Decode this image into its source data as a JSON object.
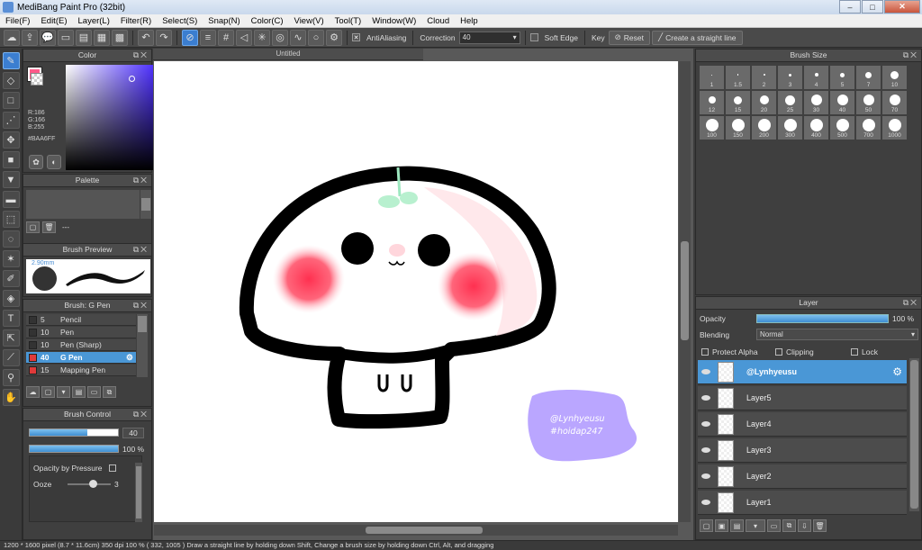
{
  "window": {
    "title": "MediBang Paint Pro (32bit)"
  },
  "menu": [
    "File(F)",
    "Edit(E)",
    "Layer(L)",
    "Filter(R)",
    "Select(S)",
    "Snap(N)",
    "Color(C)",
    "View(V)",
    "Tool(T)",
    "Window(W)",
    "Cloud",
    "Help"
  ],
  "toolbar": {
    "antialiasing_label": "AntiAliasing",
    "correction_label": "Correction",
    "correction_value": "40",
    "soft_edge_label": "Soft Edge",
    "key_label": "Key",
    "reset_label": "Reset",
    "straight_line_label": "Create a straight line"
  },
  "color_panel": {
    "title": "Color",
    "r": "R:186",
    "g": "G:166",
    "b": "B:255",
    "hex": "#BAA6FF",
    "fg_color": "#ff5a8a"
  },
  "palette_panel": {
    "title": "Palette",
    "footer_text": "---"
  },
  "brush_preview": {
    "title": "Brush Preview",
    "size_text": "2.90mm"
  },
  "brush_panel": {
    "title": "Brush: G Pen",
    "brushes": [
      {
        "size": "5",
        "name": "Pencil",
        "swatch": "#333333"
      },
      {
        "size": "10",
        "name": "Pen",
        "swatch": "#333333"
      },
      {
        "size": "10",
        "name": "Pen (Sharp)",
        "swatch": "#333333"
      },
      {
        "size": "40",
        "name": "G Pen",
        "swatch": "#e03a3a"
      },
      {
        "size": "15",
        "name": "Mapping Pen",
        "swatch": "#e03a3a"
      }
    ]
  },
  "brush_control": {
    "title": "Brush Control",
    "size_value": "40",
    "size_fraction": 0.65,
    "opacity_value": "100 %",
    "opacity_fraction": 1.0,
    "pressure_label": "Opacity by Pressure",
    "ooze_label": "Ooze",
    "ooze_value": "3"
  },
  "canvas": {
    "tab_title": "Untitled",
    "watermark_line1": "@Lynhyeusu",
    "watermark_line2": "#hoidap247"
  },
  "brush_size_panel": {
    "title": "Brush Size",
    "sizes": [
      "1",
      "1.5",
      "2",
      "3",
      "4",
      "5",
      "7",
      "10",
      "12",
      "15",
      "20",
      "25",
      "30",
      "40",
      "50",
      "70",
      "100",
      "150",
      "200",
      "300",
      "400",
      "500",
      "700",
      "1000"
    ]
  },
  "layer_panel": {
    "title": "Layer",
    "opacity_label": "Opacity",
    "opacity_value": "100 %",
    "blending_label": "Blending",
    "blending_value": "Normal",
    "protect_alpha_label": "Protect Alpha",
    "clipping_label": "Clipping",
    "lock_label": "Lock",
    "layers": [
      {
        "name": "@Lynhyeusu"
      },
      {
        "name": "Layer5"
      },
      {
        "name": "Layer4"
      },
      {
        "name": "Layer3"
      },
      {
        "name": "Layer2"
      },
      {
        "name": "Layer1"
      }
    ]
  },
  "status": {
    "text": "1200 * 1600 pixel   (8.7 * 11.6cm)   350 dpi   100 %   ( 332, 1005 )   Draw a straight line by holding down Shift, Change a brush size by holding down Ctrl, Alt, and dragging"
  }
}
